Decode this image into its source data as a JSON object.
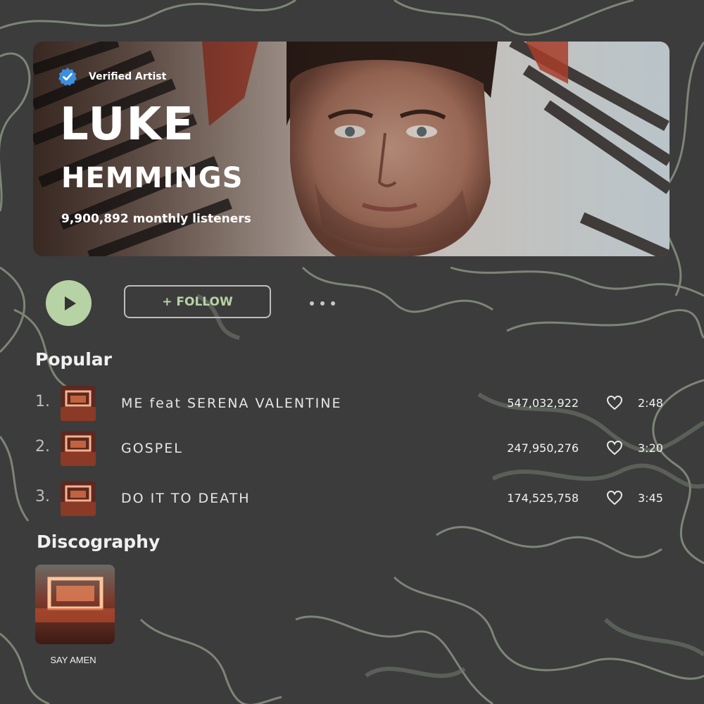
{
  "artist": {
    "verified_label": "Verified Artist",
    "name_line1": "LUKE",
    "name_line2": "HEMMINGS",
    "monthly_listeners": "9,900,892 monthly listeners"
  },
  "controls": {
    "follow_label": "+ FOLLOW"
  },
  "popular": {
    "title": "Popular",
    "tracks": [
      {
        "rank": "1.",
        "title": "ME feat SERENA VALENTINE",
        "plays": "547,032,922",
        "duration": "2:48"
      },
      {
        "rank": "2.",
        "title": "GOSPEL",
        "plays": "247,950,276",
        "duration": "3:20"
      },
      {
        "rank": "3.",
        "title": "DO IT TO DEATH",
        "plays": "174,525,758",
        "duration": "3:45"
      }
    ]
  },
  "discography": {
    "title": "Discography",
    "albums": [
      {
        "title": "SAY AMEN"
      }
    ]
  },
  "colors": {
    "accent": "#b7d2a5",
    "background": "#3a3a3a",
    "verified_badge": "#3b8fe0"
  },
  "icons": {
    "play": "play-icon",
    "heart": "heart-icon",
    "verified": "verified-check-icon",
    "more": "more-dots-icon"
  }
}
